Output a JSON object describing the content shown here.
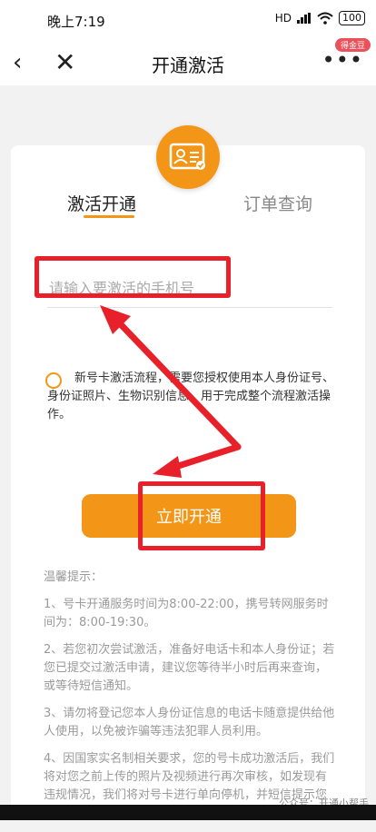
{
  "status_bar": {
    "time": "晚上7:19",
    "signal": "HD",
    "battery": "100"
  },
  "nav": {
    "back_icon": "‹",
    "close_icon": "✕",
    "title": "开通激活",
    "more_icon": "•••",
    "badge": "得金豆"
  },
  "logo": {
    "icon": "id-card-icon"
  },
  "tabs": [
    {
      "label": "激活开通",
      "active": true
    },
    {
      "label": "订单查询",
      "active": false
    }
  ],
  "phone_input": {
    "placeholder": "请输入要激活的手机号",
    "value": ""
  },
  "consent": {
    "text": "新号卡激活流程，需要您授权使用本人身份证号、身份证照片、生物识别信息，用于完成整个流程激活操作。"
  },
  "activate_button": {
    "label": "立即开通"
  },
  "tips": {
    "title": "温馨提示：",
    "items": [
      "1、号卡开通服务时间为8:00-22:00，携号转网服务时间为：8:00-19:30。",
      "2、若您初次尝试激活，准备好电话卡和本人身份证；若您已提交过激活申请，建议您等待半小时后再来查询，或等待短信通知。",
      "3、请勿将登记您本人身份证信息的电话卡随意提供给他人使用，以免被诈骗等违法犯罪人员利用。",
      "4、因国家实名制相关要求，您的号卡成功激活后，我们将对您之前上传的照片及视频进行再次审核，如发现有违规情况，我们将对号卡进行单向停机，并短信提示您重新上传资料，请您谅解。"
    ]
  },
  "watermark": "公众号：开通小帮手",
  "colors": {
    "accent": "#f39517",
    "annotation_red": "#e8202a"
  }
}
